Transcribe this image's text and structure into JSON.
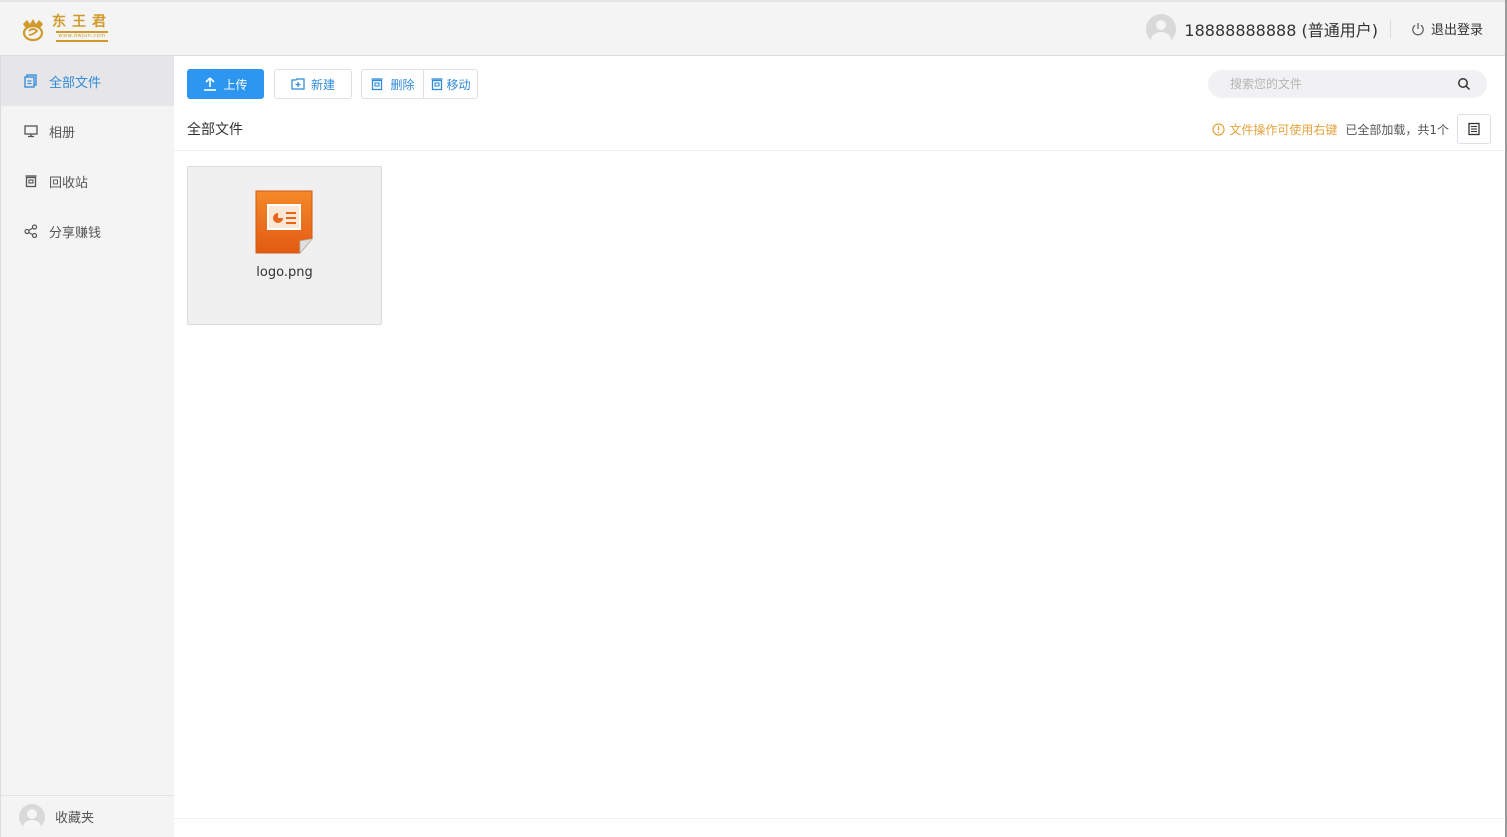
{
  "header": {
    "logo_name": "东王君",
    "logo_url": "www.dwjun.com",
    "user_label": "18888888888 (普通用户)",
    "logout_label": "退出登录"
  },
  "sidebar": {
    "items": [
      {
        "label": "全部文件",
        "icon": "files-icon",
        "active": true
      },
      {
        "label": "相册",
        "icon": "monitor-icon",
        "active": false
      },
      {
        "label": "回收站",
        "icon": "trash-icon",
        "active": false
      },
      {
        "label": "分享赚钱",
        "icon": "share-icon",
        "active": false
      }
    ],
    "bottom_label": "收藏夹"
  },
  "toolbar": {
    "upload_label": "上传",
    "new_label": "新建",
    "delete_label": "删除",
    "move_label": "移动"
  },
  "search": {
    "placeholder": "搜索您的文件"
  },
  "content": {
    "title": "全部文件",
    "hint": "文件操作可使用右键",
    "loaded_status": "已全部加载，共1个"
  },
  "files": [
    {
      "name": "logo.png",
      "icon": "presentation-file-icon"
    }
  ],
  "colors": {
    "primary": "#2d96f0",
    "active_text": "#2f8bd8",
    "hint": "#e6a23c",
    "brand_gold": "#d09b2a",
    "file_icon_orange": "#e8641b"
  }
}
